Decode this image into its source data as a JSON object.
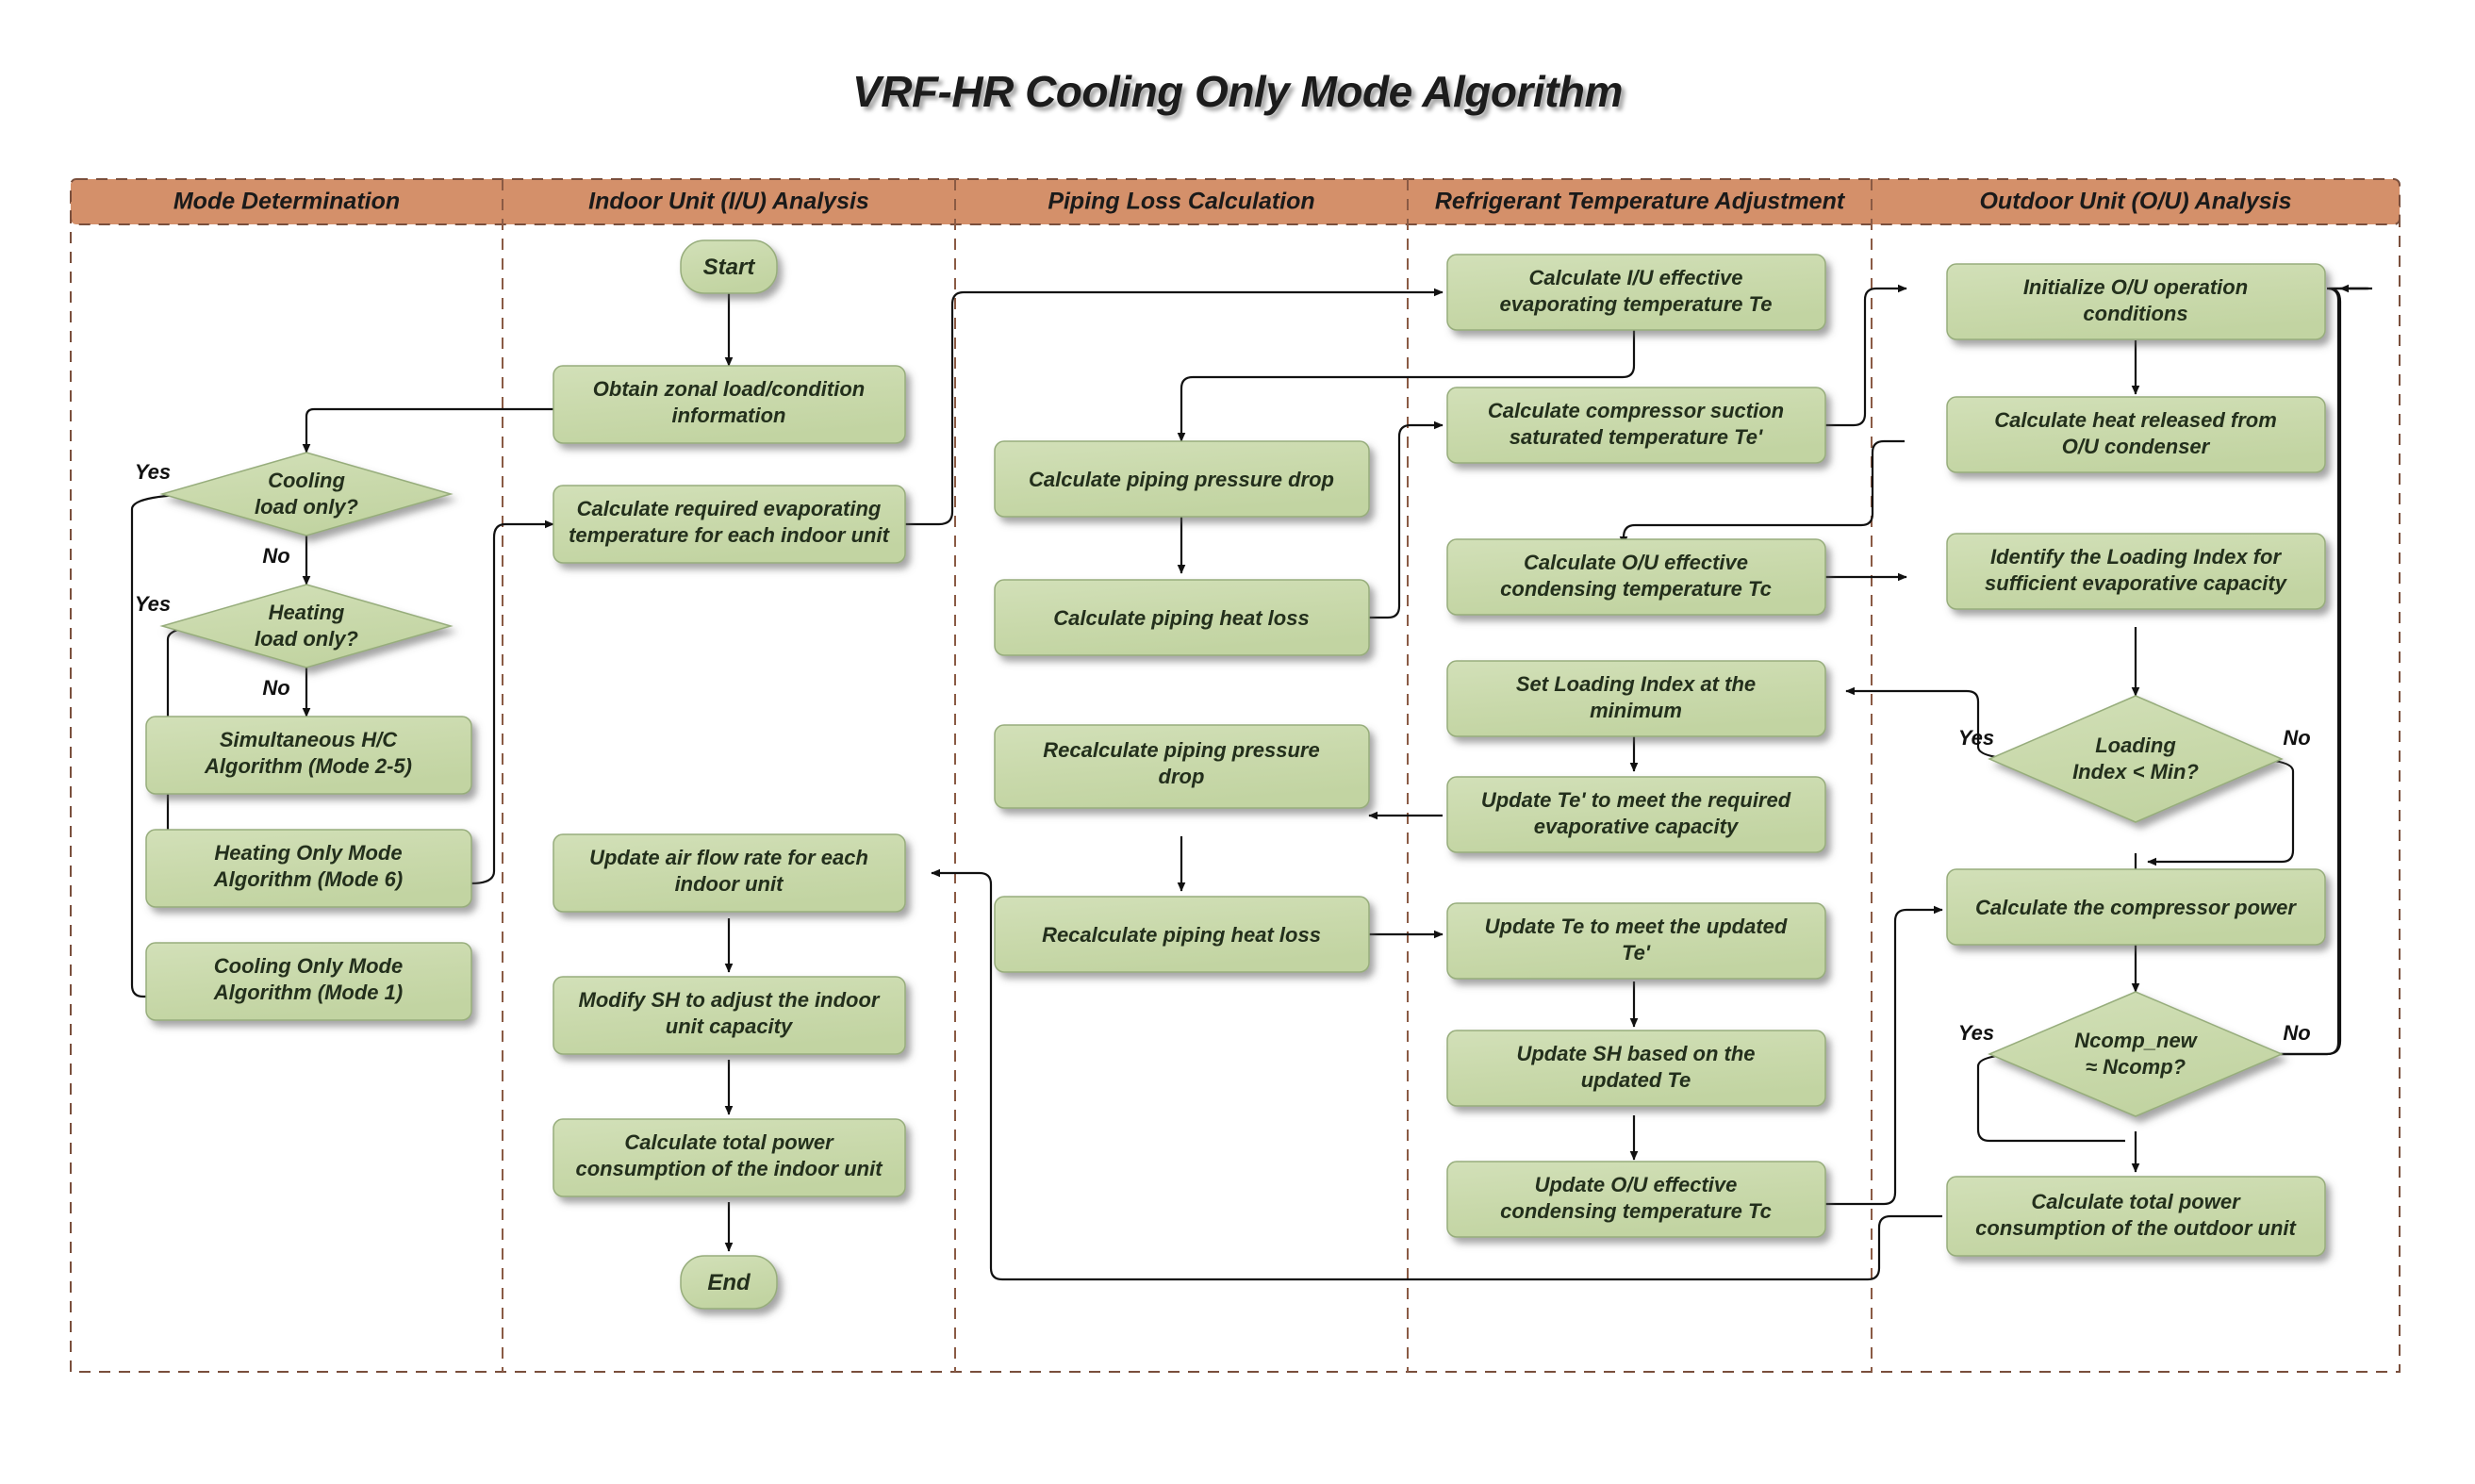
{
  "title": "VRF-HR Cooling Only Mode Algorithm",
  "colors": {
    "node_fill": "#ccdcae",
    "node_stroke": "#97ad7c",
    "lane_header_fill": "#d4906a",
    "lane_border": "#7a4f3c",
    "connector": "#111111",
    "text": "#232f1c"
  },
  "lanes": [
    {
      "id": "mode",
      "label": "Mode Determination"
    },
    {
      "id": "iu",
      "label": "Indoor Unit (I/U) Analysis"
    },
    {
      "id": "piping",
      "label": "Piping Loss Calculation"
    },
    {
      "id": "refrig",
      "label": "Refrigerant Temperature Adjustment"
    },
    {
      "id": "ou",
      "label": "Outdoor Unit (O/U) Analysis"
    }
  ],
  "nodes": {
    "start": {
      "lane": "iu",
      "type": "terminator",
      "label": "Start"
    },
    "end": {
      "lane": "iu",
      "type": "terminator",
      "label": "End"
    },
    "cooling_q": {
      "lane": "mode",
      "type": "decision",
      "line1": "Cooling",
      "line2": "load only?"
    },
    "heating_q": {
      "lane": "mode",
      "type": "decision",
      "line1": "Heating",
      "line2": "load only?"
    },
    "sim_hc": {
      "lane": "mode",
      "type": "process",
      "line1": "Simultaneous H/C",
      "line2": "Algorithm (Mode 2-5)"
    },
    "heat_only": {
      "lane": "mode",
      "type": "process",
      "line1": "Heating Only Mode",
      "line2": "Algorithm (Mode 6)"
    },
    "cool_only": {
      "lane": "mode",
      "type": "process",
      "line1": "Cooling Only Mode",
      "line2": "Algorithm (Mode 1)"
    },
    "obtain_zonal": {
      "lane": "iu",
      "type": "process",
      "line1": "Obtain zonal load/condition",
      "line2": "information"
    },
    "calc_req_te": {
      "lane": "iu",
      "type": "process",
      "line1": "Calculate required evaporating",
      "line2": "temperature for each indoor unit"
    },
    "update_air": {
      "lane": "iu",
      "type": "process",
      "line1": "Update air flow rate for each",
      "line2": "indoor unit"
    },
    "modify_sh": {
      "lane": "iu",
      "type": "process",
      "line1": "Modify SH to adjust the indoor",
      "line2": "unit capacity"
    },
    "iu_power": {
      "lane": "iu",
      "type": "process",
      "line1": "Calculate total power",
      "line2": "consumption of the indoor unit"
    },
    "pipe_dp": {
      "lane": "piping",
      "type": "process",
      "line1": "Calculate piping pressure drop",
      "line2": ""
    },
    "pipe_heat": {
      "lane": "piping",
      "type": "process",
      "line1": "Calculate piping  heat loss",
      "line2": ""
    },
    "repipe_dp": {
      "lane": "piping",
      "type": "process",
      "line1": "Recalculate piping pressure",
      "line2": "drop"
    },
    "repipe_heat": {
      "lane": "piping",
      "type": "process",
      "line1": "Recalculate piping heat loss",
      "line2": ""
    },
    "iu_te": {
      "lane": "refrig",
      "type": "process",
      "line1": "Calculate I/U effective",
      "line2": "evaporating temperature Te"
    },
    "comp_suction": {
      "lane": "refrig",
      "type": "process",
      "line1": "Calculate compressor suction",
      "line2": "saturated temperature Te'"
    },
    "ou_tc": {
      "lane": "refrig",
      "type": "process",
      "line1": "Calculate O/U effective",
      "line2": "condensing temperature Tc"
    },
    "set_li_min": {
      "lane": "refrig",
      "type": "process",
      "line1": "Set Loading Index at the",
      "line2": "minimum"
    },
    "update_tep": {
      "lane": "refrig",
      "type": "process",
      "line1": "Update Te' to meet the required",
      "line2": "evaporative capacity"
    },
    "update_te": {
      "lane": "refrig",
      "type": "process",
      "line1": "Update Te to meet the updated",
      "line2": "Te'"
    },
    "update_sh": {
      "lane": "refrig",
      "type": "process",
      "line1": "Update SH based on the",
      "line2": "updated Te"
    },
    "update_tc": {
      "lane": "refrig",
      "type": "process",
      "line1": "Update O/U effective",
      "line2": "condensing temperature Tc"
    },
    "init_ou": {
      "lane": "ou",
      "type": "process",
      "line1": "Initialize O/U operation",
      "line2": "conditions"
    },
    "heat_cond": {
      "lane": "ou",
      "type": "process",
      "line1": "Calculate heat released from",
      "line2": "O/U condenser"
    },
    "identify_li": {
      "lane": "ou",
      "type": "process",
      "line1": "Identify the Loading Index for",
      "line2": "sufficient evaporative capacity"
    },
    "li_min_q": {
      "lane": "ou",
      "type": "decision",
      "line1": "Loading",
      "line2": "Index < Min?"
    },
    "comp_power": {
      "lane": "ou",
      "type": "process",
      "line1": "Calculate the compressor power",
      "line2": ""
    },
    "ncomp_q": {
      "lane": "ou",
      "type": "decision",
      "line1": "Ncomp_new",
      "line2": "≈  Ncomp?"
    },
    "ou_power": {
      "lane": "ou",
      "type": "process",
      "line1": "Calculate total power",
      "line2": "consumption of the outdoor unit"
    }
  },
  "edge_labels": {
    "cooling_yes": "Yes",
    "cooling_no": "No",
    "heating_yes": "Yes",
    "heating_no": "No",
    "li_yes": "Yes",
    "li_no": "No",
    "ncomp_yes": "Yes",
    "ncomp_no": "No"
  }
}
